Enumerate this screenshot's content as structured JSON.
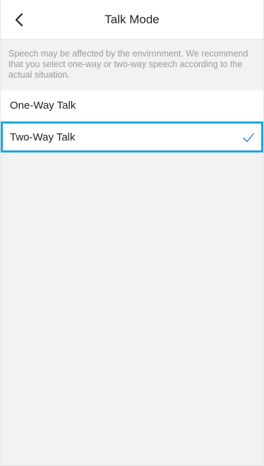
{
  "header": {
    "title": "Talk Mode",
    "back_icon": "chevron-left-icon"
  },
  "notice": {
    "text": "Speech may be affected by the environment. We recommend that you select one-way or two-way speech according to the actual situation."
  },
  "options": [
    {
      "label": "One-Way Talk",
      "selected": false
    },
    {
      "label": "Two-Way Talk",
      "selected": true,
      "indicator": "checkmark-icon"
    }
  ],
  "colors": {
    "accent": "#4a90e2",
    "highlight_border": "#1ca7e0",
    "hint_text": "#9a9a9a",
    "background": "#f2f2f2"
  }
}
